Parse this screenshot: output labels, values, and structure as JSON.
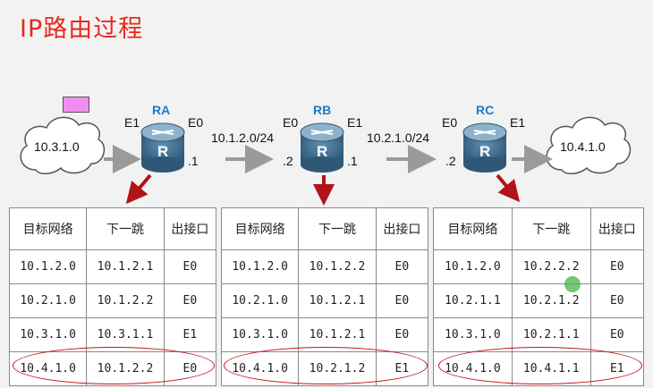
{
  "title": "IP路由过程",
  "colors": {
    "title": "#e8281e",
    "router_label": "#1c7bc8",
    "arrow_red": "#b01417",
    "highlight": "#c0131b",
    "marker": "#ef8ef0"
  },
  "networks": {
    "left_cloud": "10.3.1.0",
    "right_cloud": "10.4.1.0",
    "link_ab": "10.1.2.0/24",
    "link_bc": "10.2.1.0/24"
  },
  "routers": [
    {
      "name": "RA",
      "left_if": "E1",
      "right_if": "E0",
      "right_addr": ".1",
      "glyph": "R"
    },
    {
      "name": "RB",
      "left_if": "E0",
      "right_if": "E1",
      "left_addr": ".2",
      "right_addr": ".1",
      "glyph": "R"
    },
    {
      "name": "RC",
      "left_if": "E0",
      "right_if": "E1",
      "left_addr": ".2",
      "glyph": "R"
    }
  ],
  "tables": [
    {
      "headers": [
        "目标网络",
        "下一跳",
        "出接口"
      ],
      "rows": [
        [
          "10.1.2.0",
          "10.1.2.1",
          "E0"
        ],
        [
          "10.2.1.0",
          "10.1.2.2",
          "E0"
        ],
        [
          "10.3.1.0",
          "10.3.1.1",
          "E1"
        ],
        [
          "10.4.1.0",
          "10.1.2.2",
          "E0"
        ]
      ]
    },
    {
      "headers": [
        "目标网络",
        "下一跳",
        "出接口"
      ],
      "rows": [
        [
          "10.1.2.0",
          "10.1.2.2",
          "E0"
        ],
        [
          "10.2.1.0",
          "10.1.2.1",
          "E0"
        ],
        [
          "10.3.1.0",
          "10.1.2.1",
          "E0"
        ],
        [
          "10.4.1.0",
          "10.2.1.2",
          "E1"
        ]
      ]
    },
    {
      "headers": [
        "目标网络",
        "下一跳",
        "出接口"
      ],
      "rows": [
        [
          "10.1.2.0",
          "10.2.2.2",
          "E0"
        ],
        [
          "10.2.1.1",
          "10.2.1.2",
          "E0"
        ],
        [
          "10.3.1.0",
          "10.2.1.1",
          "E0"
        ],
        [
          "10.4.1.0",
          "10.4.1.1",
          "E1"
        ]
      ]
    }
  ]
}
